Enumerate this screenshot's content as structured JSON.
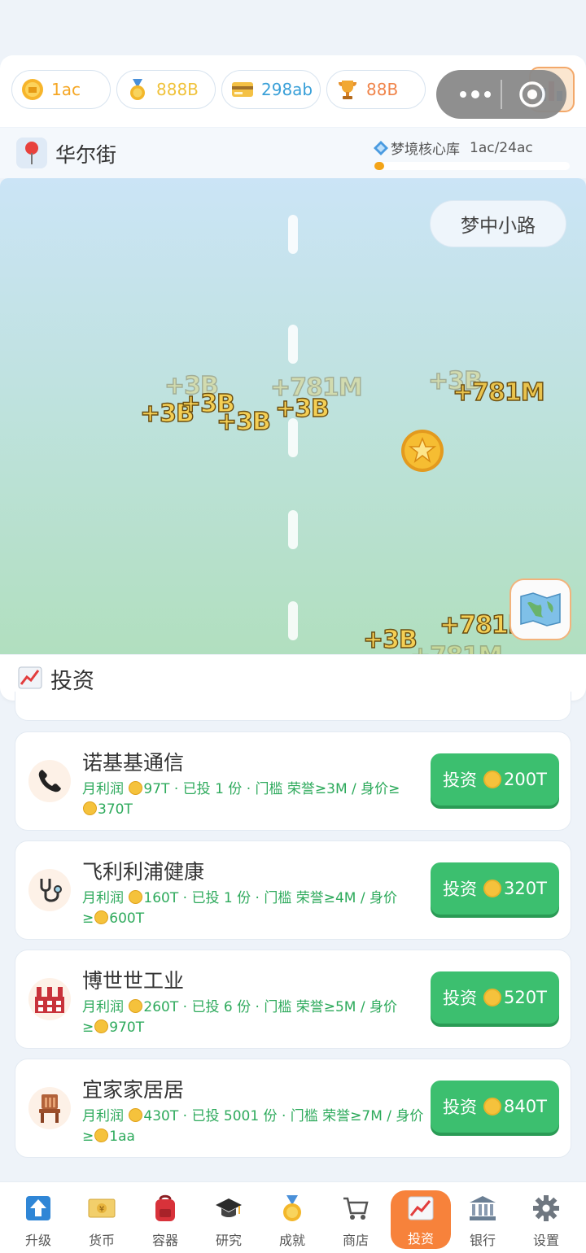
{
  "resources": [
    {
      "name": "coin",
      "value": "1ac",
      "color": "#f5a623",
      "icon": "coin-icon"
    },
    {
      "name": "medal",
      "value": "888B",
      "color": "#f0c23a",
      "icon": "medal-icon"
    },
    {
      "name": "card",
      "value": "298ab",
      "color": "#3aa0d8",
      "icon": "card-icon"
    },
    {
      "name": "trophy",
      "value": "88B",
      "color": "#f0844a",
      "icon": "trophy-icon"
    }
  ],
  "location": {
    "name": "华尔街",
    "core_label": "梦境核心库",
    "core_value": "1ac/24ac",
    "progress": 0.042
  },
  "scene": {
    "route_label": "梦中小路",
    "floaters": [
      "+3B",
      "+3B",
      "+3B",
      "+3B",
      "+781M",
      "+3B",
      "+3B",
      "+781M",
      "+3B",
      "+781M",
      "+781M"
    ]
  },
  "invest": {
    "title": "投资",
    "items": [
      {
        "name": "诺基基通信",
        "profit": "97T",
        "shares": "1",
        "honor": "3M",
        "worth": "370T",
        "button_label": "投资",
        "cost": "200T",
        "icon": "phone-icon"
      },
      {
        "name": "飞利利浦健康",
        "profit": "160T",
        "shares": "1",
        "honor": "4M",
        "worth": "600T",
        "button_label": "投资",
        "cost": "320T",
        "icon": "stethoscope-icon"
      },
      {
        "name": "博世世工业",
        "profit": "260T",
        "shares": "6",
        "honor": "5M",
        "worth": "970T",
        "button_label": "投资",
        "cost": "520T",
        "icon": "factory-icon"
      },
      {
        "name": "宜家家居居",
        "profit": "430T",
        "shares": "5001",
        "honor": "7M",
        "worth": "1aa",
        "button_label": "投资",
        "cost": "840T",
        "icon": "chair-icon"
      }
    ],
    "text": {
      "profit_prefix": "月利润",
      "shares_prefix": "· 已投",
      "shares_suffix": "份 · 门槛 荣誉≥",
      "worth_prefix": "/ 身价≥"
    }
  },
  "nav": [
    {
      "label": "升级",
      "icon": "upgrade-icon"
    },
    {
      "label": "货币",
      "icon": "currency-icon"
    },
    {
      "label": "容器",
      "icon": "backpack-icon"
    },
    {
      "label": "研究",
      "icon": "graduation-cap-icon"
    },
    {
      "label": "成就",
      "icon": "medal-icon"
    },
    {
      "label": "商店",
      "icon": "cart-icon"
    },
    {
      "label": "投资",
      "icon": "chart-icon",
      "active": true
    },
    {
      "label": "银行",
      "icon": "bank-icon"
    },
    {
      "label": "设置",
      "icon": "gear-icon"
    }
  ]
}
